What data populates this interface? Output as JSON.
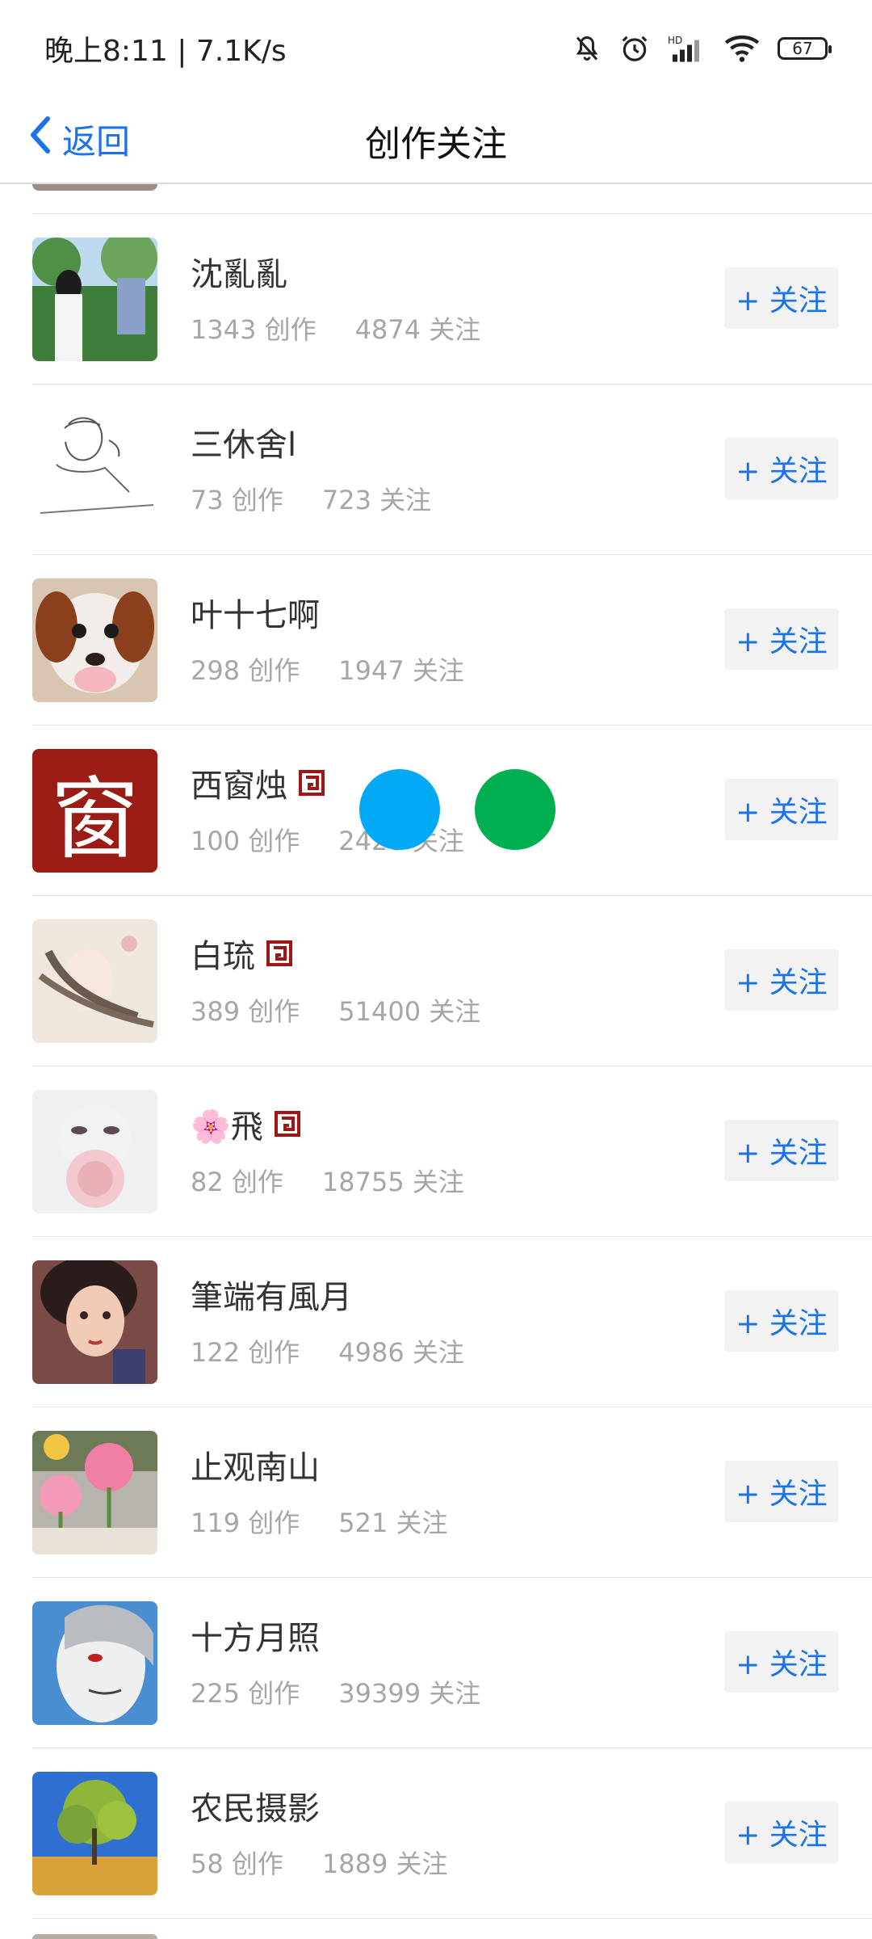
{
  "status": {
    "time_speed": "晚上8:11 | 7.1K/s",
    "icons": [
      "bell-off-icon",
      "alarm-icon",
      "hd-signal-icon",
      "wifi-icon"
    ],
    "battery": "67"
  },
  "nav": {
    "back_label": "返回",
    "title": "创作关注"
  },
  "colors": {
    "accent": "#1a73e8",
    "floating_blue": "#03a9f4",
    "floating_green": "#00b050",
    "badge_red": "#a31515"
  },
  "list": {
    "follow_label": "+ 关注",
    "items": [
      {
        "name": "沈亂亂",
        "works": "1343 创作",
        "follows": "4874 关注",
        "badge": false
      },
      {
        "name": "三休舍l",
        "works": "73 创作",
        "follows": "723 关注",
        "badge": false
      },
      {
        "name": "叶十七啊",
        "works": "298 创作",
        "follows": "1947 关注",
        "badge": false
      },
      {
        "name": "西窗烛",
        "works": "100 创作",
        "follows": "2428 关注",
        "badge": true,
        "avatar_char": "窗"
      },
      {
        "name": "白琉",
        "works": "389 创作",
        "follows": "51400 关注",
        "badge": true
      },
      {
        "name": "🌸飛",
        "works": "82 创作",
        "follows": "18755 关注",
        "badge": true
      },
      {
        "name": "筆端有風月",
        "works": "122 创作",
        "follows": "4986 关注",
        "badge": false
      },
      {
        "name": "止观南山",
        "works": "119 创作",
        "follows": "521 关注",
        "badge": false
      },
      {
        "name": "十方月照",
        "works": "225 创作",
        "follows": "39399 关注",
        "badge": false
      },
      {
        "name": "农民摄影",
        "works": "58 创作",
        "follows": "1889 关注",
        "badge": false
      }
    ]
  }
}
